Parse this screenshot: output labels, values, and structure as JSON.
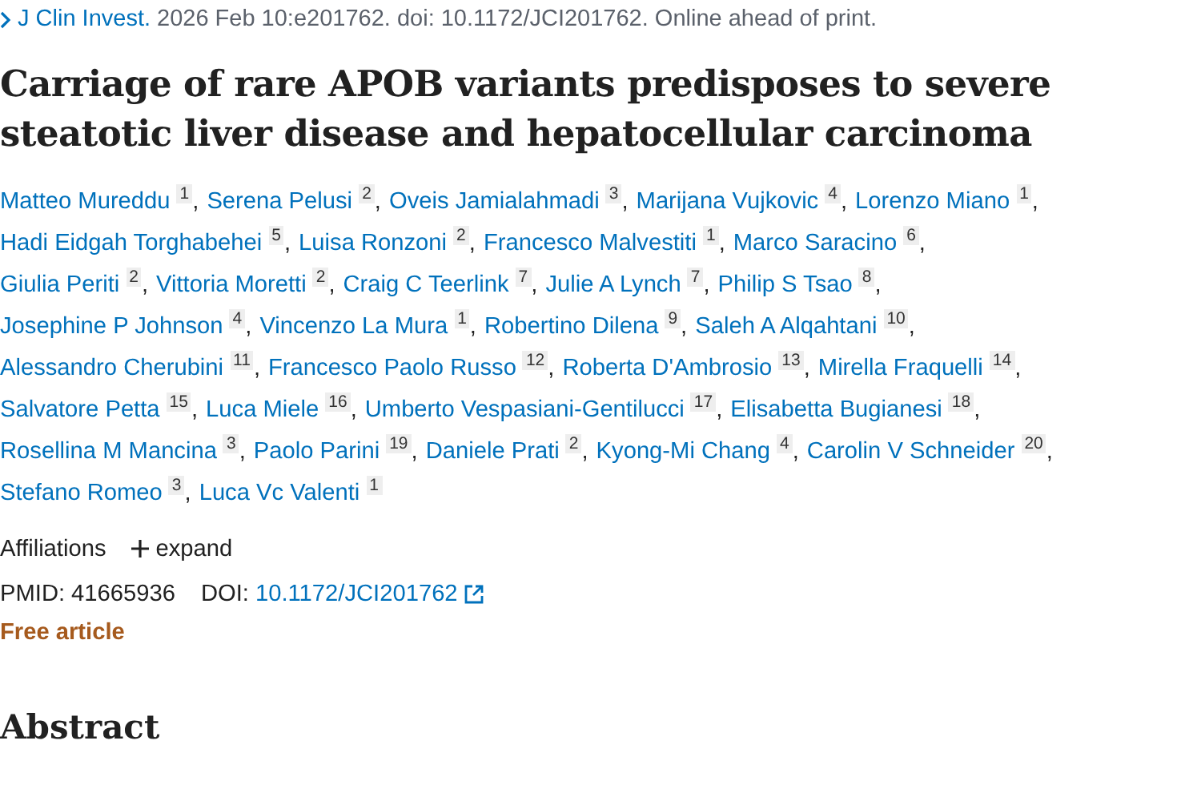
{
  "citation": {
    "journal": "J Clin Invest.",
    "details": "2026 Feb 10:e201762. doi: 10.1172/JCI201762. Online ahead of print."
  },
  "title": "Carriage of rare APOB variants predisposes to severe steatotic liver disease and hepatocellular carcinoma",
  "author_lines": [
    [
      {
        "name": "Matteo Mureddu",
        "affiliation": "1",
        "separator": ","
      },
      {
        "name": "Serena Pelusi",
        "affiliation": "2",
        "separator": ","
      },
      {
        "name": "Oveis Jamialahmadi",
        "affiliation": "3",
        "separator": ","
      },
      {
        "name": "Marijana Vujkovic",
        "affiliation": "4",
        "separator": ","
      },
      {
        "name": "Lorenzo Miano",
        "affiliation": "1",
        "separator": ","
      }
    ],
    [
      {
        "name": "Hadi Eidgah Torghabehei",
        "affiliation": "5",
        "separator": ","
      },
      {
        "name": "Luisa Ronzoni",
        "affiliation": "2",
        "separator": ","
      },
      {
        "name": "Francesco Malvestiti",
        "affiliation": "1",
        "separator": ","
      },
      {
        "name": "Marco Saracino",
        "affiliation": "6",
        "separator": ","
      }
    ],
    [
      {
        "name": "Giulia Periti",
        "affiliation": "2",
        "separator": ","
      },
      {
        "name": "Vittoria Moretti",
        "affiliation": "2",
        "separator": ","
      },
      {
        "name": "Craig C Teerlink",
        "affiliation": "7",
        "separator": ","
      },
      {
        "name": "Julie A Lynch",
        "affiliation": "7",
        "separator": ","
      },
      {
        "name": "Philip S Tsao",
        "affiliation": "8",
        "separator": ","
      }
    ],
    [
      {
        "name": "Josephine P Johnson",
        "affiliation": "4",
        "separator": ","
      },
      {
        "name": "Vincenzo La Mura",
        "affiliation": "1",
        "separator": ","
      },
      {
        "name": "Robertino Dilena",
        "affiliation": "9",
        "separator": ","
      },
      {
        "name": "Saleh A Alqahtani",
        "affiliation": "10",
        "separator": ","
      }
    ],
    [
      {
        "name": "Alessandro Cherubini",
        "affiliation": "11",
        "separator": ","
      },
      {
        "name": "Francesco Paolo Russo",
        "affiliation": "12",
        "separator": ","
      },
      {
        "name": "Roberta D'Ambrosio",
        "affiliation": "13",
        "separator": ","
      },
      {
        "name": "Mirella Fraquelli",
        "affiliation": "14",
        "separator": ","
      }
    ],
    [
      {
        "name": "Salvatore Petta",
        "affiliation": "15",
        "separator": ","
      },
      {
        "name": "Luca Miele",
        "affiliation": "16",
        "separator": ","
      },
      {
        "name": "Umberto Vespasiani-Gentilucci",
        "affiliation": "17",
        "separator": ","
      },
      {
        "name": "Elisabetta Bugianesi",
        "affiliation": "18",
        "separator": ","
      }
    ],
    [
      {
        "name": "Rosellina M Mancina",
        "affiliation": "3",
        "separator": ","
      },
      {
        "name": "Paolo Parini",
        "affiliation": "19",
        "separator": ","
      },
      {
        "name": "Daniele Prati",
        "affiliation": "2",
        "separator": ","
      },
      {
        "name": "Kyong-Mi Chang",
        "affiliation": "4",
        "separator": ","
      },
      {
        "name": "Carolin V Schneider",
        "affiliation": "20",
        "separator": ","
      }
    ],
    [
      {
        "name": "Stefano Romeo",
        "affiliation": "3",
        "separator": ","
      },
      {
        "name": "Luca Vc Valenti",
        "affiliation": "1"
      }
    ]
  ],
  "affiliations": {
    "label": "Affiliations",
    "toggle": "expand",
    "expanded": false
  },
  "identifiers": {
    "pmid_label": "PMID:",
    "pmid": "41665936",
    "doi_label": "DOI:",
    "doi": "10.1172/JCI201762"
  },
  "access": "Free article",
  "section_heading": "Abstract"
}
